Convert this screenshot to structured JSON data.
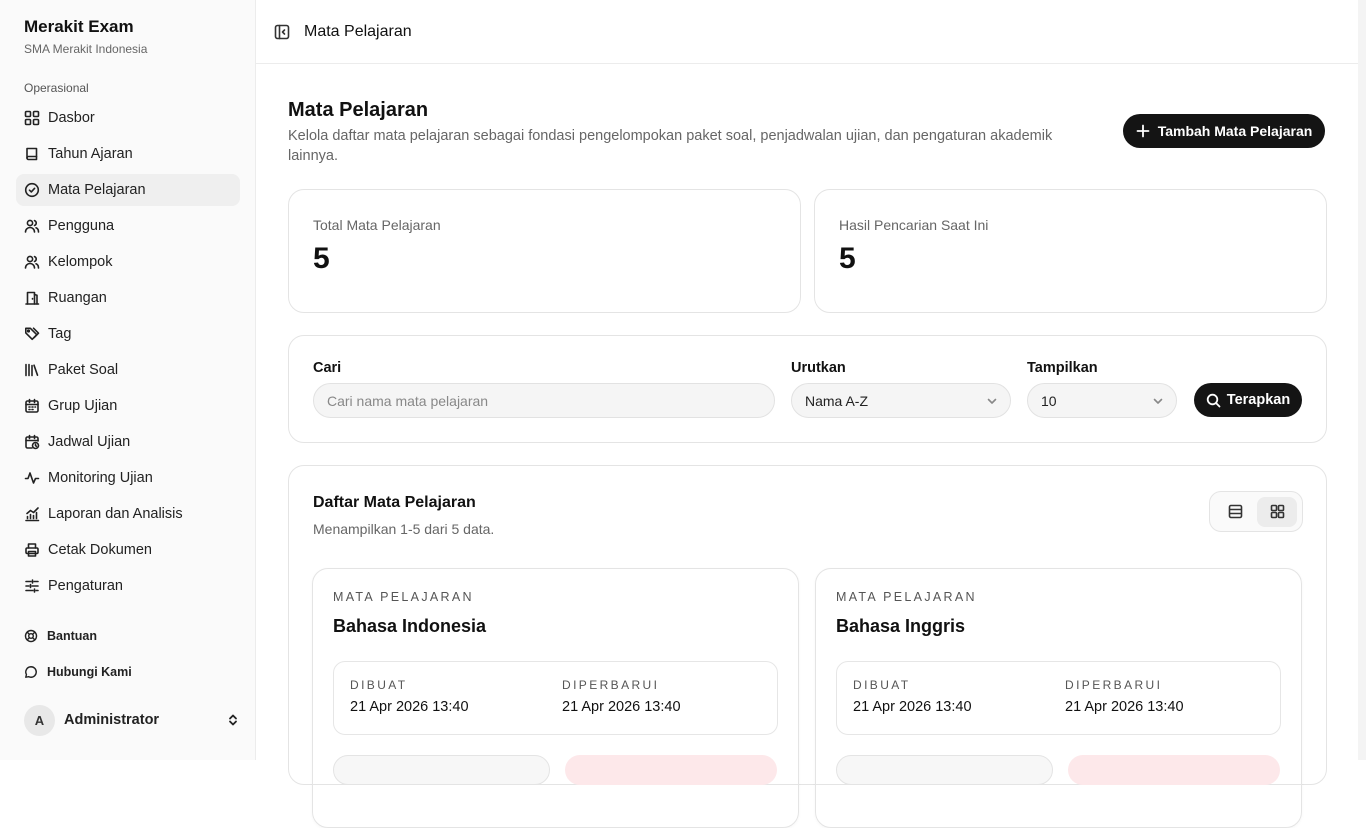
{
  "app": {
    "name": "Merakit Exam",
    "school": "SMA Merakit Indonesia"
  },
  "sidebar": {
    "section_label": "Operasional",
    "items": [
      {
        "label": "Dasbor",
        "icon": "dashboard-grid-icon"
      },
      {
        "label": "Tahun Ajaran",
        "icon": "book-icon"
      },
      {
        "label": "Mata Pelajaran",
        "icon": "check-circle-icon",
        "active": true
      },
      {
        "label": "Pengguna",
        "icon": "users-icon"
      },
      {
        "label": "Kelompok",
        "icon": "users-group-icon"
      },
      {
        "label": "Ruangan",
        "icon": "door-icon"
      },
      {
        "label": "Tag",
        "icon": "tag-icon"
      },
      {
        "label": "Paket Soal",
        "icon": "library-icon"
      },
      {
        "label": "Grup Ujian",
        "icon": "calendar-icon"
      },
      {
        "label": "Jadwal Ujian",
        "icon": "calendar-clock-icon"
      },
      {
        "label": "Monitoring Ujian",
        "icon": "activity-icon"
      },
      {
        "label": "Laporan dan Analisis",
        "icon": "chart-icon"
      },
      {
        "label": "Cetak Dokumen",
        "icon": "printer-icon"
      },
      {
        "label": "Pengaturan",
        "icon": "sliders-icon"
      }
    ],
    "secondary": [
      {
        "label": "Bantuan",
        "icon": "lifebuoy-icon"
      },
      {
        "label": "Hubungi Kami",
        "icon": "message-icon"
      }
    ],
    "user": {
      "initial": "A",
      "name": "Administrator"
    }
  },
  "topbar": {
    "breadcrumb": "Mata Pelajaran"
  },
  "page": {
    "title": "Mata Pelajaran",
    "description": "Kelola daftar mata pelajaran sebagai fondasi pengelompokan paket soal, penjadwalan ujian, dan pengaturan akademik lainnya.",
    "add_button": "Tambah Mata Pelajaran"
  },
  "stats": [
    {
      "label": "Total Mata Pelajaran",
      "value": "5"
    },
    {
      "label": "Hasil Pencarian Saat Ini",
      "value": "5"
    }
  ],
  "filters": {
    "search_label": "Cari",
    "search_placeholder": "Cari nama mata pelajaran",
    "sort_label": "Urutkan",
    "sort_value": "Nama A-Z",
    "show_label": "Tampilkan",
    "show_value": "10",
    "apply_button": "Terapkan"
  },
  "list": {
    "title": "Daftar Mata Pelajaran",
    "subtitle": "Menampilkan 1-5 dari 5 data.",
    "view_mode": "grid"
  },
  "cards": [
    {
      "kicker": "MATA PELAJARAN",
      "name": "Bahasa Indonesia",
      "created_label": "DIBUAT",
      "created": "21 Apr 2026 13:40",
      "updated_label": "DIPERBARUI",
      "updated": "21 Apr 2026 13:40"
    },
    {
      "kicker": "MATA PELAJARAN",
      "name": "Bahasa Inggris",
      "created_label": "DIBUAT",
      "created": "21 Apr 2026 13:40",
      "updated_label": "DIPERBARUI",
      "updated": "21 Apr 2026 13:40"
    }
  ]
}
